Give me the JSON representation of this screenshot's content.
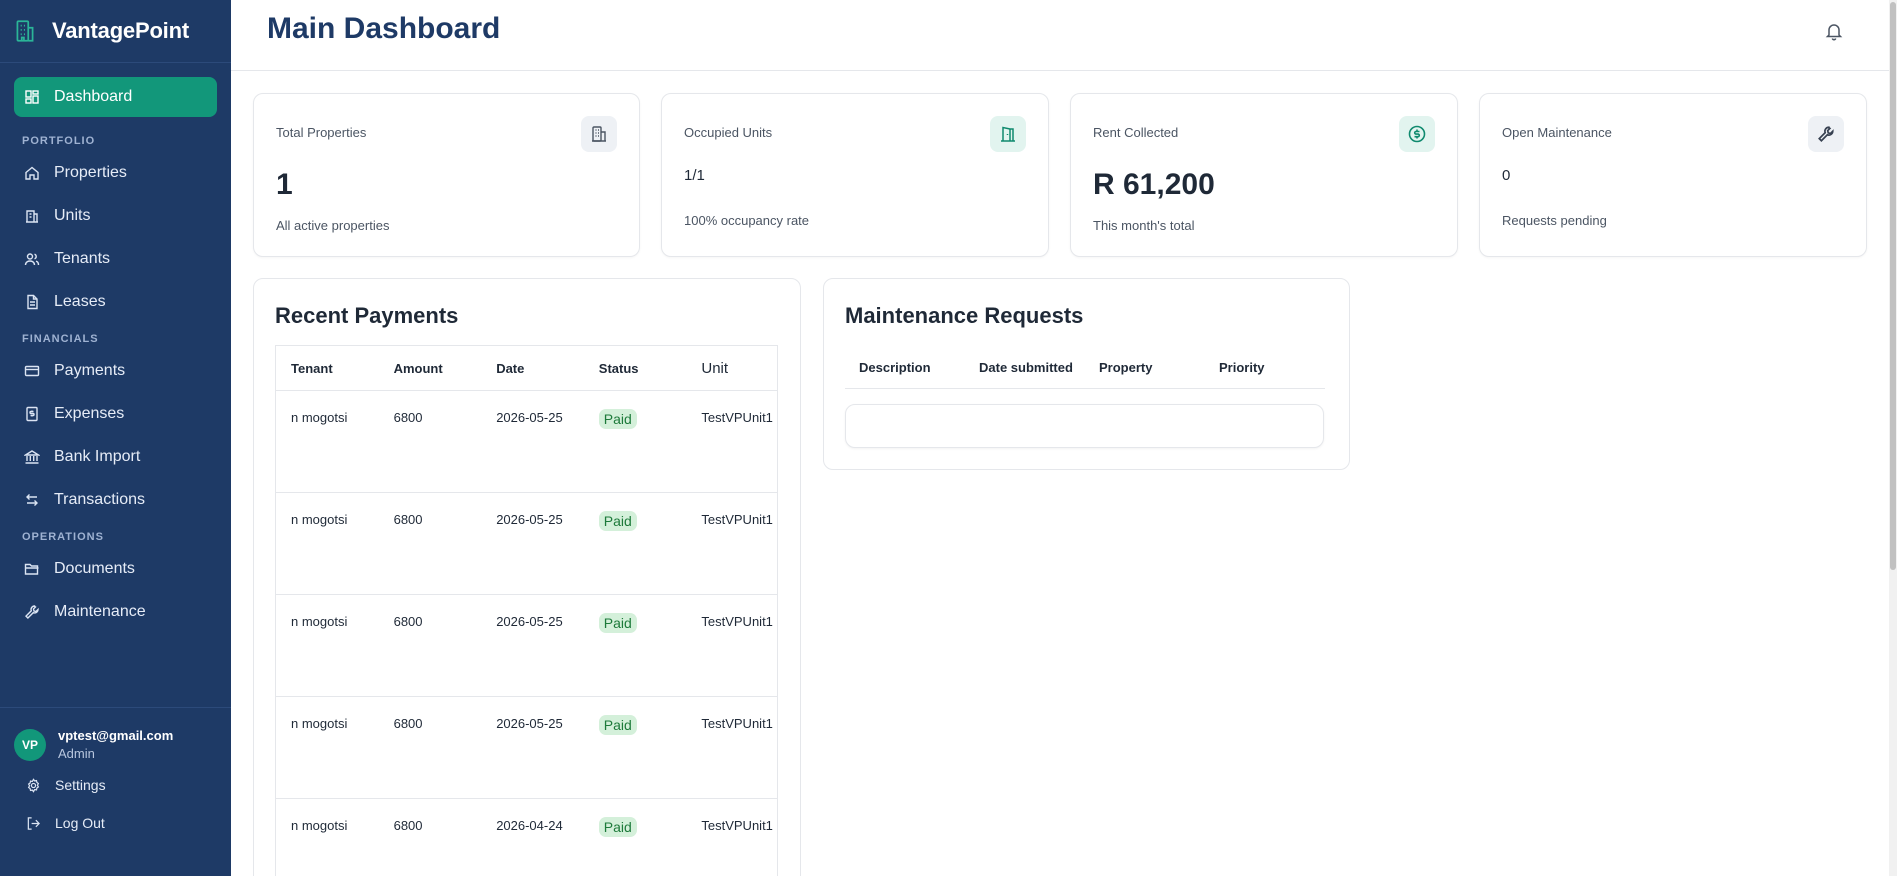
{
  "app": {
    "name": "VantagePoint"
  },
  "sidebar": {
    "dashboard": "Dashboard",
    "sections": [
      {
        "title": "PORTFOLIO",
        "items": [
          {
            "label": "Properties",
            "icon": "home-icon"
          },
          {
            "label": "Units",
            "icon": "building-columns-icon"
          },
          {
            "label": "Tenants",
            "icon": "users-icon"
          },
          {
            "label": "Leases",
            "icon": "document-icon"
          }
        ]
      },
      {
        "title": "FINANCIALS",
        "items": [
          {
            "label": "Payments",
            "icon": "credit-card-icon"
          },
          {
            "label": "Expenses",
            "icon": "receipt-icon"
          },
          {
            "label": "Bank Import",
            "icon": "bank-icon"
          },
          {
            "label": "Transactions",
            "icon": "arrows-swap-icon"
          }
        ]
      },
      {
        "title": "OPERATIONS",
        "items": [
          {
            "label": "Documents",
            "icon": "folder-icon"
          },
          {
            "label": "Maintenance",
            "icon": "wrench-icon"
          }
        ]
      }
    ]
  },
  "user": {
    "initials": "VP",
    "email": "vptest@gmail.com",
    "role": "Admin",
    "settings": "Settings",
    "logout": "Log Out"
  },
  "header": {
    "title": "Main Dashboard"
  },
  "cards": [
    {
      "label": "Total Properties",
      "value": "1",
      "sub": "All active properties",
      "icon": "building-icon",
      "icon_bg": "#eef1f5",
      "icon_color": "#4b5563"
    },
    {
      "label": "Occupied Units",
      "value": "1/1",
      "sub": "100% occupancy rate",
      "icon": "door-icon",
      "icon_bg": "#e2f4ef",
      "icon_color": "#0f8a6e"
    },
    {
      "label": "Rent Collected",
      "value": "R 61,200",
      "sub": "This month's total",
      "icon": "dollar-circle-icon",
      "icon_bg": "#e2f4ef",
      "icon_color": "#0f8a6e"
    },
    {
      "label": "Open Maintenance",
      "value": "0",
      "sub": "Requests pending",
      "icon": "wrench-icon",
      "icon_bg": "#eef1f5",
      "icon_color": "#374151"
    }
  ],
  "payments": {
    "title": "Recent Payments",
    "columns": [
      "Tenant",
      "Amount",
      "Date",
      "Status",
      "Unit"
    ],
    "rows": [
      {
        "tenant": "n mogotsi",
        "amount": "6800",
        "date": "2026-05-25",
        "status": "Paid",
        "unit": "TestVPUnit1"
      },
      {
        "tenant": "n mogotsi",
        "amount": "6800",
        "date": "2026-05-25",
        "status": "Paid",
        "unit": "TestVPUnit1"
      },
      {
        "tenant": "n mogotsi",
        "amount": "6800",
        "date": "2026-05-25",
        "status": "Paid",
        "unit": "TestVPUnit1"
      },
      {
        "tenant": "n mogotsi",
        "amount": "6800",
        "date": "2026-05-25",
        "status": "Paid",
        "unit": "TestVPUnit1"
      },
      {
        "tenant": "n mogotsi",
        "amount": "6800",
        "date": "2026-04-24",
        "status": "Paid",
        "unit": "TestVPUnit1"
      }
    ]
  },
  "maintenance": {
    "title": "Maintenance Requests",
    "columns": [
      "Description",
      "Date submitted",
      "Property",
      "Priority"
    ]
  },
  "colors": {
    "sidebar": "#1e3a66",
    "accent": "#12977a",
    "title": "#1e3a66",
    "paid_bg": "#d4f0da",
    "paid_text": "#1d7a3a"
  }
}
